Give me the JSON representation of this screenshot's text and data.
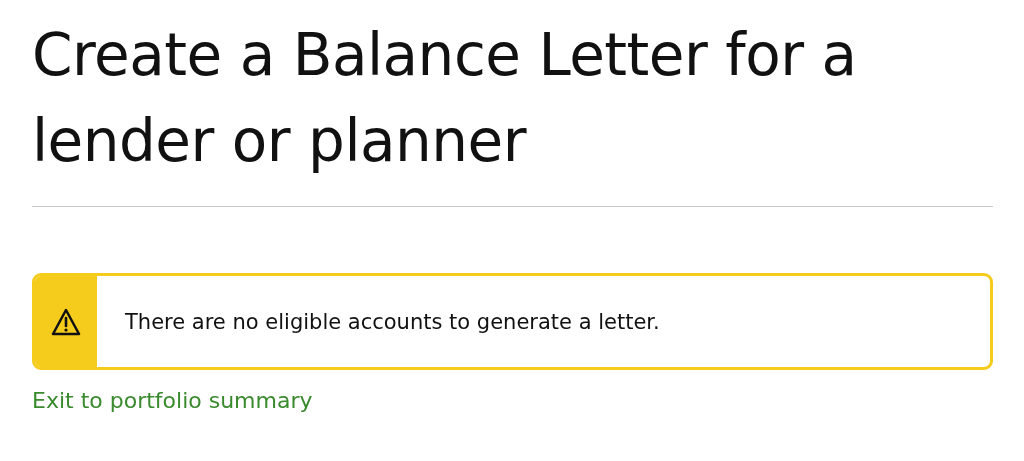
{
  "title": "Create a Balance Letter for a lender or planner",
  "alert": {
    "message": "There are no eligible accounts to generate a letter."
  },
  "link": "Exit to portfolio summary"
}
